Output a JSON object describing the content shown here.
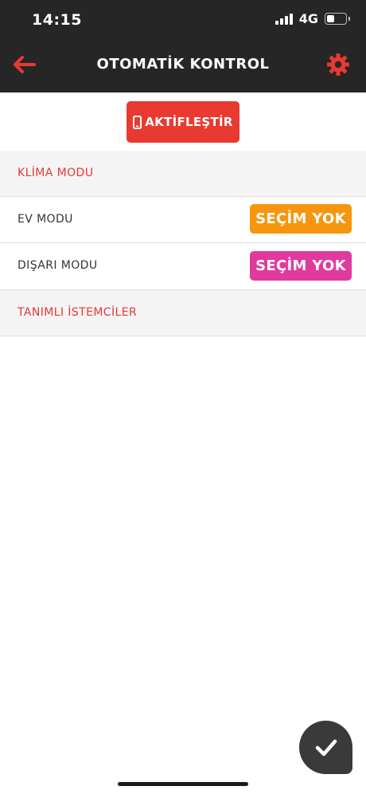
{
  "status_bar": {
    "time": "14:15",
    "network": "4G"
  },
  "nav": {
    "title": "OTOMATİK KONTROL"
  },
  "activate": {
    "label": "AKTİFLEŞTİR"
  },
  "sections": {
    "klima": "KLİMA MODU",
    "clients": "TANIMLI İSTEMCİLER"
  },
  "modes": [
    {
      "label": "EV MODU",
      "button": "SEÇİM YOK",
      "color": "#f7960c"
    },
    {
      "label": "DIŞARI MODU",
      "button": "SEÇİM YOK",
      "color": "#e03a9d"
    }
  ],
  "colors": {
    "accent": "#e83a31",
    "header_bg": "#262626",
    "fab_bg": "#3a3a3a"
  },
  "icons": {
    "back": "arrow-left-icon",
    "settings": "gear-icon",
    "phone": "phone-icon",
    "confirm": "checkmark-icon"
  }
}
